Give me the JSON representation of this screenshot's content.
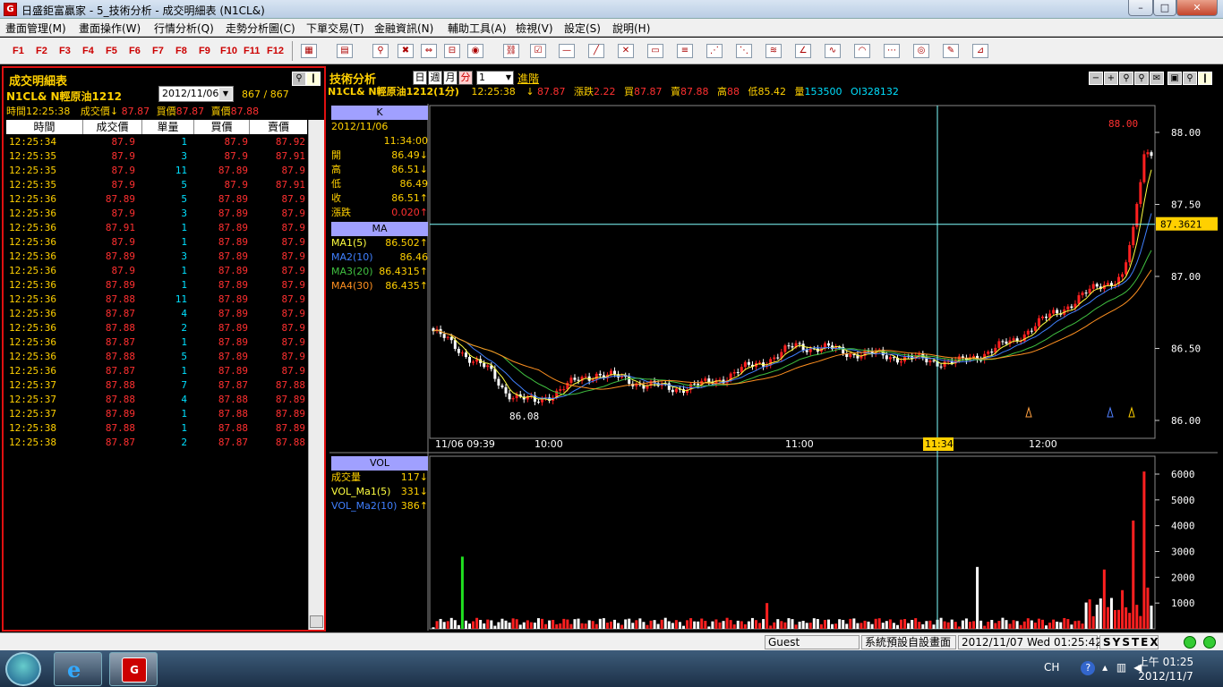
{
  "window": {
    "title": "日盛鉅富贏家 - 5_技術分析 - 成交明細表 (N1CL&)",
    "logo_glyph": "G"
  },
  "menu": [
    "畫面管理(M)",
    "畫面操作(W)",
    "行情分析(Q)",
    "走勢分析圖(C)",
    "下單交易(T)",
    "金融資訊(N)",
    "輔助工具(A)",
    "檢視(V)",
    "設定(S)",
    "說明(H)"
  ],
  "fkeys": [
    "F1",
    "F2",
    "F3",
    "F4",
    "F5",
    "F6",
    "F7",
    "F8",
    "F9",
    "F10",
    "F11",
    "F12"
  ],
  "trade_panel": {
    "title": "成交明細表",
    "symbol": "N1CL&  N輕原油1212",
    "date": "2012/11/06",
    "count": "867 / 867",
    "info_time": "時間12:25:38",
    "info_px_label": "成交價↓",
    "info_px": "87.87",
    "info_bid_label": "買價",
    "info_bid": "87.87",
    "info_ask_label": "賣價",
    "info_ask": "87.88",
    "headers": [
      "時間",
      "成交價",
      "單量",
      "買價",
      "賣價"
    ],
    "rows": [
      [
        "12:25:34",
        "87.9",
        "1",
        "87.9",
        "87.92"
      ],
      [
        "12:25:35",
        "87.9",
        "3",
        "87.9",
        "87.91"
      ],
      [
        "12:25:35",
        "87.9",
        "11",
        "87.89",
        "87.9"
      ],
      [
        "12:25:35",
        "87.9",
        "5",
        "87.9",
        "87.91"
      ],
      [
        "12:25:36",
        "87.89",
        "5",
        "87.89",
        "87.9"
      ],
      [
        "12:25:36",
        "87.9",
        "3",
        "87.89",
        "87.9"
      ],
      [
        "12:25:36",
        "87.91",
        "1",
        "87.89",
        "87.9"
      ],
      [
        "12:25:36",
        "87.9",
        "1",
        "87.89",
        "87.9"
      ],
      [
        "12:25:36",
        "87.89",
        "3",
        "87.89",
        "87.9"
      ],
      [
        "12:25:36",
        "87.9",
        "1",
        "87.89",
        "87.9"
      ],
      [
        "12:25:36",
        "87.89",
        "1",
        "87.89",
        "87.9"
      ],
      [
        "12:25:36",
        "87.88",
        "11",
        "87.89",
        "87.9"
      ],
      [
        "12:25:36",
        "87.87",
        "4",
        "87.89",
        "87.9"
      ],
      [
        "12:25:36",
        "87.88",
        "2",
        "87.89",
        "87.9"
      ],
      [
        "12:25:36",
        "87.87",
        "1",
        "87.89",
        "87.9"
      ],
      [
        "12:25:36",
        "87.88",
        "5",
        "87.89",
        "87.9"
      ],
      [
        "12:25:36",
        "87.87",
        "1",
        "87.89",
        "87.9"
      ],
      [
        "12:25:37",
        "87.88",
        "7",
        "87.87",
        "87.88"
      ],
      [
        "12:25:37",
        "87.88",
        "4",
        "87.88",
        "87.89"
      ],
      [
        "12:25:37",
        "87.89",
        "1",
        "87.88",
        "87.89"
      ],
      [
        "12:25:38",
        "87.88",
        "1",
        "87.88",
        "87.89"
      ],
      [
        "12:25:38",
        "87.87",
        "2",
        "87.87",
        "87.88"
      ]
    ]
  },
  "tech_panel": {
    "title": "技術分析",
    "periods": [
      "日",
      "週",
      "月",
      "分"
    ],
    "period_value": "1",
    "advanced": "進階",
    "quote": {
      "symbol": "N1CL&  N輕原油1212(1分)",
      "time": "12:25:38",
      "arrow": "↓",
      "last": "87.87",
      "chg_label": "漲跌",
      "chg": "2.22",
      "bid_label": "買",
      "bid": "87.87",
      "ask_label": "賣",
      "ask": "87.88",
      "high_label": "高",
      "high": "88",
      "low_label": "低",
      "low": "85.42",
      "vol_label": "量",
      "vol": "153500",
      "oi_label": "OI",
      "oi": "328132"
    },
    "k_box": {
      "head": "K",
      "date": "2012/11/06",
      "time": "11:34:00",
      "rows": [
        [
          "開",
          "86.49↓"
        ],
        [
          "高",
          "86.51↓"
        ],
        [
          "低",
          "86.49"
        ],
        [
          "收",
          "86.51↑"
        ],
        [
          "漲跌",
          "0.020↑"
        ]
      ]
    },
    "ma_box": {
      "head": "MA",
      "rows": [
        [
          "MA1(5)",
          "86.502↑"
        ],
        [
          "MA2(10)",
          "86.46"
        ],
        [
          "MA3(20)",
          "86.4315↑"
        ],
        [
          "MA4(30)",
          "86.435↑"
        ]
      ]
    },
    "vol_box": {
      "head": "VOL",
      "rows": [
        [
          "成交量",
          "117↓"
        ],
        [
          "VOL_Ma1(5)",
          "331↓"
        ],
        [
          "VOL_Ma2(10)",
          "386↑"
        ]
      ]
    },
    "price_axis": [
      "88.00",
      "87.50",
      "87.00",
      "86.50",
      "86.00"
    ],
    "crosshair_price": "87.3621",
    "max_label": "88.00",
    "min_label": "86.08",
    "time_axis": [
      "11/06 09:39",
      "10:00",
      "11:00",
      "11:34",
      "12:00"
    ],
    "vol_axis": [
      "6000",
      "5000",
      "4000",
      "3000",
      "2000",
      "1000"
    ]
  },
  "status": {
    "user": "Guest",
    "layout": "系統預設自設畫面",
    "datetime": "2012/11/07 Wed 01:25:42",
    "brand": "SYSTEX"
  },
  "taskbar": {
    "lang": "CH",
    "time": "上午 01:25",
    "date": "2012/11/7"
  },
  "colors": {
    "up": "#ff2020",
    "down": "#ffffff",
    "ma1": "#ffff40",
    "ma2": "#4080ff",
    "ma3": "#40c040",
    "ma4": "#ff9020",
    "crosshair": "#80ffff"
  }
}
